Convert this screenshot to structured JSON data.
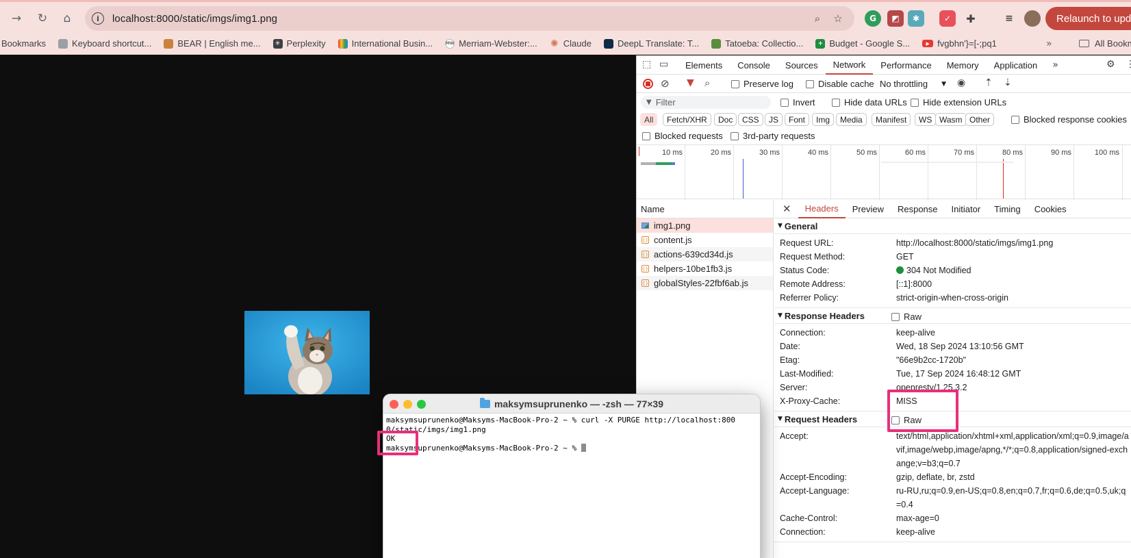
{
  "browser": {
    "url": "localhost:8000/static/imgs/img1.png",
    "relaunch_label": "Relaunch to update"
  },
  "bookmarks": {
    "items": [
      {
        "label": "Bookmarks",
        "icon": "",
        "color": ""
      },
      {
        "label": "Keyboard shortcut...",
        "icon": "keyboard-icon",
        "color": "#9aa0a6"
      },
      {
        "label": "BEAR | English me...",
        "icon": "bear-icon",
        "color": "#c8843a"
      },
      {
        "label": "Perplexity",
        "icon": "perplexity-icon",
        "color": "#3c4043"
      },
      {
        "label": "International Busin...",
        "icon": "nbc-icon",
        "color": "#e0a03a"
      },
      {
        "label": "Merriam-Webster:...",
        "icon": "mw-icon",
        "color": "#b9b9b9"
      },
      {
        "label": "Claude",
        "icon": "claude-icon",
        "color": "#d97757"
      },
      {
        "label": "DeepL Translate: T...",
        "icon": "deepl-icon",
        "color": "#0f2b46"
      },
      {
        "label": "Tatoeba: Collectio...",
        "icon": "tatoeba-icon",
        "color": "#5a8c3c"
      },
      {
        "label": "Budget - Google S...",
        "icon": "sheets-icon",
        "color": "#1e8e3e"
      },
      {
        "label": "fvgbhn'}=[-;pq1",
        "icon": "youtube-icon",
        "color": "#e53935"
      }
    ],
    "all_bookmarks": "All Bookmarks"
  },
  "devtools": {
    "tabs": [
      "Elements",
      "Console",
      "Sources",
      "Network",
      "Performance",
      "Memory",
      "Application"
    ],
    "active_tab": "Network",
    "preserve_log": "Preserve log",
    "disable_cache": "Disable cache",
    "throttling": "No throttling",
    "filter_placeholder": "Filter",
    "invert": "Invert",
    "hide_data_urls": "Hide data URLs",
    "hide_extension_urls": "Hide extension URLs",
    "chips": [
      "All",
      "Fetch/XHR",
      "Doc",
      "CSS",
      "JS",
      "Font",
      "Img",
      "Media",
      "Manifest",
      "WS",
      "Wasm",
      "Other"
    ],
    "blocked_response_cookies": "Blocked response cookies",
    "blocked_requests": "Blocked requests",
    "third_party_requests": "3rd-party requests",
    "timeline_ticks": [
      "10 ms",
      "20 ms",
      "30 ms",
      "40 ms",
      "50 ms",
      "60 ms",
      "70 ms",
      "80 ms",
      "90 ms",
      "100 ms"
    ],
    "name_header": "Name",
    "requests": [
      {
        "name": "img1.png",
        "type": "image"
      },
      {
        "name": "content.js",
        "type": "script"
      },
      {
        "name": "actions-639cd34d.js",
        "type": "script"
      },
      {
        "name": "helpers-10be1fb3.js",
        "type": "script"
      },
      {
        "name": "globalStyles-22fbf6ab.js",
        "type": "script"
      }
    ],
    "detail_tabs": [
      "Headers",
      "Preview",
      "Response",
      "Initiator",
      "Timing",
      "Cookies"
    ],
    "general": {
      "title": "General",
      "rows": [
        {
          "k": "Request URL:",
          "v": "http://localhost:8000/static/imgs/img1.png"
        },
        {
          "k": "Request Method:",
          "v": "GET"
        },
        {
          "k": "Status Code:",
          "v": "304 Not Modified"
        },
        {
          "k": "Remote Address:",
          "v": "[::1]:8000"
        },
        {
          "k": "Referrer Policy:",
          "v": "strict-origin-when-cross-origin"
        }
      ]
    },
    "response_headers": {
      "title": "Response Headers",
      "raw": "Raw",
      "rows": [
        {
          "k": "Connection:",
          "v": "keep-alive"
        },
        {
          "k": "Date:",
          "v": "Wed, 18 Sep 2024 13:10:56 GMT"
        },
        {
          "k": "Etag:",
          "v": "\"66e9b2cc-1720b\""
        },
        {
          "k": "Last-Modified:",
          "v": "Tue, 17 Sep 2024 16:48:12 GMT"
        },
        {
          "k": "Server:",
          "v": "openresty/1.25.3.2"
        },
        {
          "k": "X-Proxy-Cache:",
          "v": "MISS"
        }
      ]
    },
    "request_headers": {
      "title": "Request Headers",
      "raw": "Raw",
      "rows": [
        {
          "k": "Accept:",
          "v": "text/html,application/xhtml+xml,application/xml;q=0.9,image/avif,image/webp,image/apng,*/*;q=0.8,application/signed-exchange;v=b3;q=0.7"
        },
        {
          "k": "Accept-Encoding:",
          "v": "gzip, deflate, br, zstd"
        },
        {
          "k": "Accept-Language:",
          "v": "ru-RU,ru;q=0.9,en-US;q=0.8,en;q=0.7,fr;q=0.6,de;q=0.5,uk;q=0.4"
        },
        {
          "k": "Cache-Control:",
          "v": "max-age=0"
        },
        {
          "k": "Connection:",
          "v": "keep-alive"
        }
      ]
    }
  },
  "terminal": {
    "title": "maksymsuprunenko — -zsh — 77×39",
    "line1": "maksymsuprunenko@Maksyms-MacBook-Pro-2 ~ % curl -X PURGE http://localhost:8000/static/imgs/img1.png",
    "line1a": "maksymsuprunenko@Maksyms-MacBook-Pro-2 ~ % curl -X PURGE http://localhost:800",
    "line1b": "0/static/imgs/img1.png",
    "line2": "OK",
    "line3": "maksymsuprunenko@Maksyms-MacBook-Pro-2 ~ % "
  },
  "colors": {
    "accent": "#c4473e",
    "highlight": "#e82f7a",
    "status_ok": "#1e8e3e"
  }
}
